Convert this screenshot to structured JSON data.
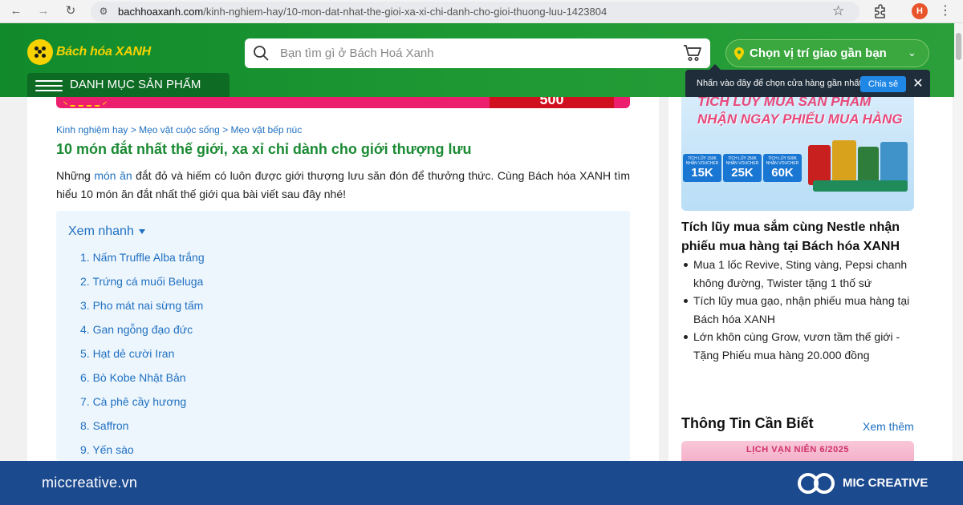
{
  "browser": {
    "url_host": "bachhoaxanh.com",
    "url_path": "/kinh-nghiem-hay/10-mon-dat-nhat-the-gioi-xa-xi-chi-danh-cho-gioi-thuong-luu-1423804",
    "profile_initial": "H"
  },
  "header": {
    "logo_text": "Bách hóa XANH",
    "search_placeholder": "Bạn tìm gì ở Bách Hoá Xanh",
    "location_label": "Chọn vị trí giao gần bạn",
    "menu_label": "DANH MỤC SẢN PHẨM",
    "tooltip_text": "Nhấn vào đây để chọn cửa hàng gần nhất",
    "tooltip_button": "Chia sẻ"
  },
  "banner": {
    "partial_text": "500"
  },
  "article": {
    "breadcrumb": "Kinh nghiệm hay > Mẹo vặt cuộc sống > Mẹo vặt bếp núc",
    "title": "10 món đắt nhất thế giới, xa xỉ chỉ dành cho giới thượng lưu",
    "intro_before": "Những ",
    "intro_link": "món ăn",
    "intro_after": " đắt đỏ và hiếm có luôn được giới thượng lưu săn đón để thưởng thức. Cùng Bách hóa XANH tìm hiểu 10 món ăn đắt nhất thế giới qua bài viết sau đây nhé!",
    "toc_title": "Xem nhanh",
    "toc": [
      "1. Nấm Truffle Alba trắng",
      "2. Trứng cá muối Beluga",
      "3. Pho mát nai sừng tấm",
      "4. Gan ngỗng đạo đức",
      "5. Hạt dẻ cười Iran",
      "6. Bò Kobe Nhật Bản",
      "7. Cà phê cầy hương",
      "8. Saffron",
      "9. Yến sào"
    ]
  },
  "sidebar": {
    "promo": {
      "line1": "TÍCH LŨY MUA SẢN PHẨM",
      "line2": "NHẬN NGAY PHIẾU MUA HÀNG",
      "tiers": [
        {
          "caption": "TÍCH LŨY 150K NHẬN VOUCHER",
          "value": "15K"
        },
        {
          "caption": "TÍCH LŨY 250K NHẬN VOUCHER",
          "value": "25K"
        },
        {
          "caption": "TÍCH LŨY 500K NHẬN VOUCHER",
          "value": "60K"
        }
      ]
    },
    "heading": "Tích lũy mua sắm cùng Nestle nhận phiếu mua hàng tại Bách hóa XANH",
    "items": [
      "Mua 1 lốc Revive, Sting vàng, Pepsi chanh không đường, Twister tặng 1 thố sứ",
      "Tích lũy mua gạo, nhận phiếu mua hàng tại Bách hóa XANH",
      "Lớn khôn cùng Grow, vươn tầm thế giới - Tặng Phiếu mua hàng 20.000 đồng"
    ],
    "info_title": "Thông Tin Cần Biết",
    "info_more": "Xem thêm",
    "calendar_text": "LỊCH VẠN NIÊN 6/2025"
  },
  "footer": {
    "site": "miccreative.vn",
    "brand": "MIC CREATIVE"
  },
  "colors": {
    "header_green": "#1f9a34",
    "title_green": "#1a8a33",
    "link_blue": "#1f70c1",
    "footer_blue": "#1c4a8e"
  }
}
